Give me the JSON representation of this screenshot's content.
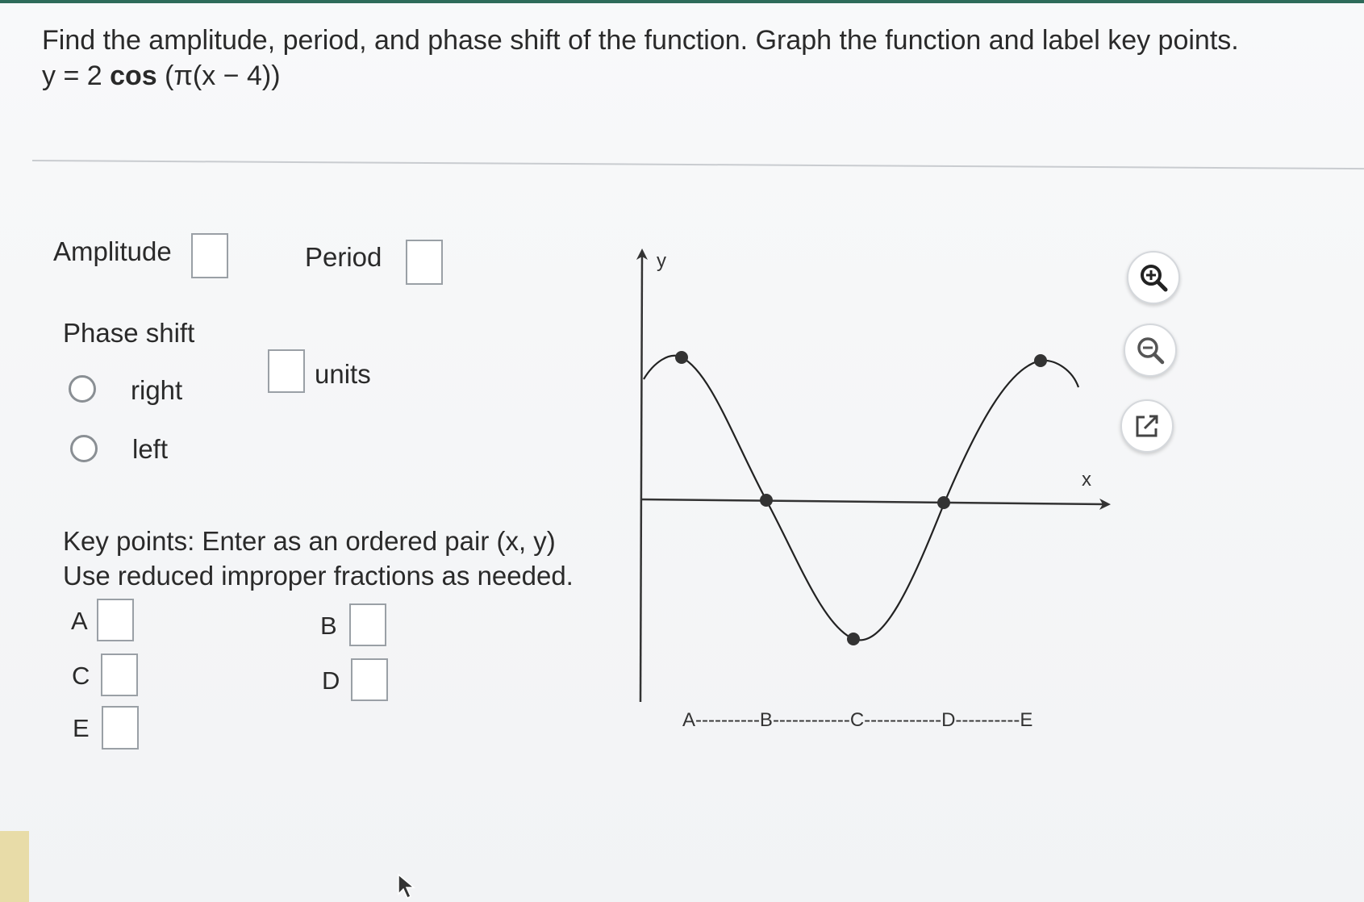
{
  "question": {
    "prompt": "Find the amplitude, period, and phase shift of the function. Graph the function and label key points.",
    "formula_prefix": "y = 2 ",
    "formula_cos": "cos",
    "formula_suffix": " (π(x − 4))"
  },
  "fields": {
    "amplitude_label": "Amplitude",
    "period_label": "Period",
    "phase_shift_label": "Phase shift",
    "units_label": "units",
    "direction_options": [
      "right",
      "left"
    ]
  },
  "key_points": {
    "instruction_line1": "Key points: Enter as an ordered pair (x, y)",
    "instruction_line2": "Use reduced improper fractions as needed.",
    "labels": [
      "A",
      "B",
      "C",
      "D",
      "E"
    ]
  },
  "graph": {
    "y_axis_label": "y",
    "x_axis_label": "x",
    "point_sequence_label": "A----------B------------C------------D----------E",
    "curve": "cosine",
    "key_points_shown": [
      "max",
      "zero",
      "min",
      "zero",
      "max"
    ]
  },
  "tools": {
    "zoom_in_icon": "zoom-in-icon",
    "zoom_out_icon": "zoom-out-icon",
    "popout_icon": "external-link-icon"
  }
}
